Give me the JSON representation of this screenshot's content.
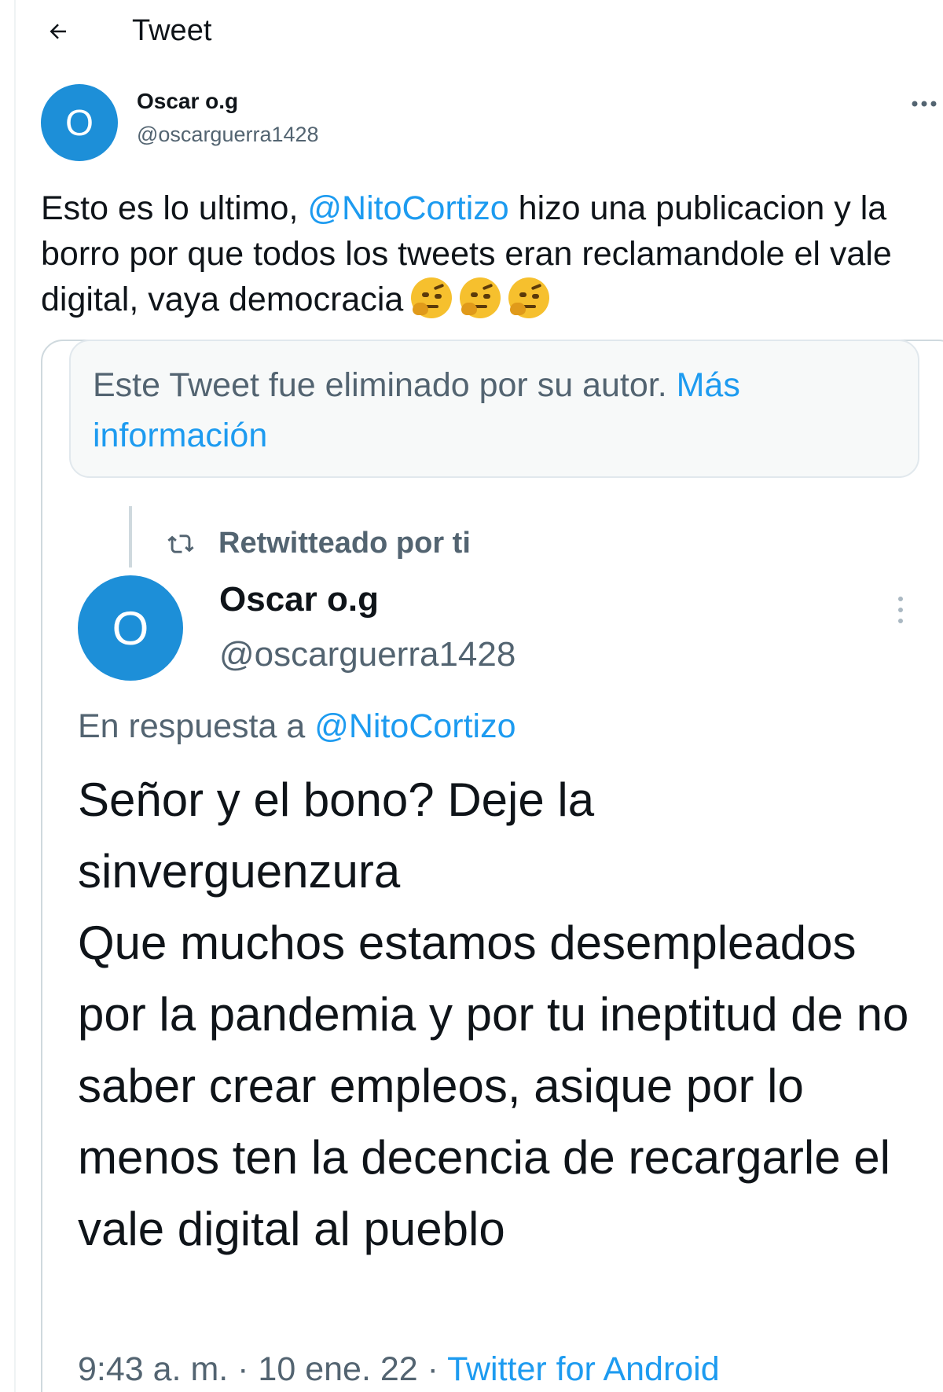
{
  "header": {
    "title": "Tweet"
  },
  "tweet": {
    "avatar_letter": "O",
    "author_name": "Oscar o.g",
    "author_handle": "@oscarguerra1428",
    "text_part1": "Esto es lo ultimo, ",
    "mention": "@NitoCortizo",
    "text_part2": " hizo una publicacion y la borro por que todos los tweets eran reclamandole el vale digital, vaya democracia",
    "emojis": [
      "face-with-raised-eyebrow",
      "face-with-raised-eyebrow",
      "face-with-raised-eyebrow"
    ]
  },
  "deleted_notice": {
    "text": "Este Tweet fue eliminado por su autor. ",
    "link": "Más información"
  },
  "retweet": {
    "label": "Retwitteado por ti"
  },
  "inner_tweet": {
    "avatar_letter": "O",
    "author_name": "Oscar o.g",
    "author_handle": "@oscarguerra1428",
    "reply_prefix": "En respuesta a ",
    "reply_mention": "@NitoCortizo",
    "text": "Señor y el bono? Deje la sinverguenzura\nQue muchos estamos desempleados por la pandemia y por tu ineptitud de no saber crear empleos, asique por lo menos ten la decencia de recargarle el vale digital al pueblo",
    "time": "9:43 a. m. · 10 ene. 22 · ",
    "source": "Twitter for Android"
  },
  "icons": {
    "back": "arrow-left-icon",
    "more": "more-horizontal-icon",
    "retweet": "retweet-icon",
    "more_vertical": "more-vertical-icon"
  },
  "colors": {
    "accent": "#1d9bf0",
    "avatar": "#1d8fd8",
    "secondary_text": "#536471"
  }
}
